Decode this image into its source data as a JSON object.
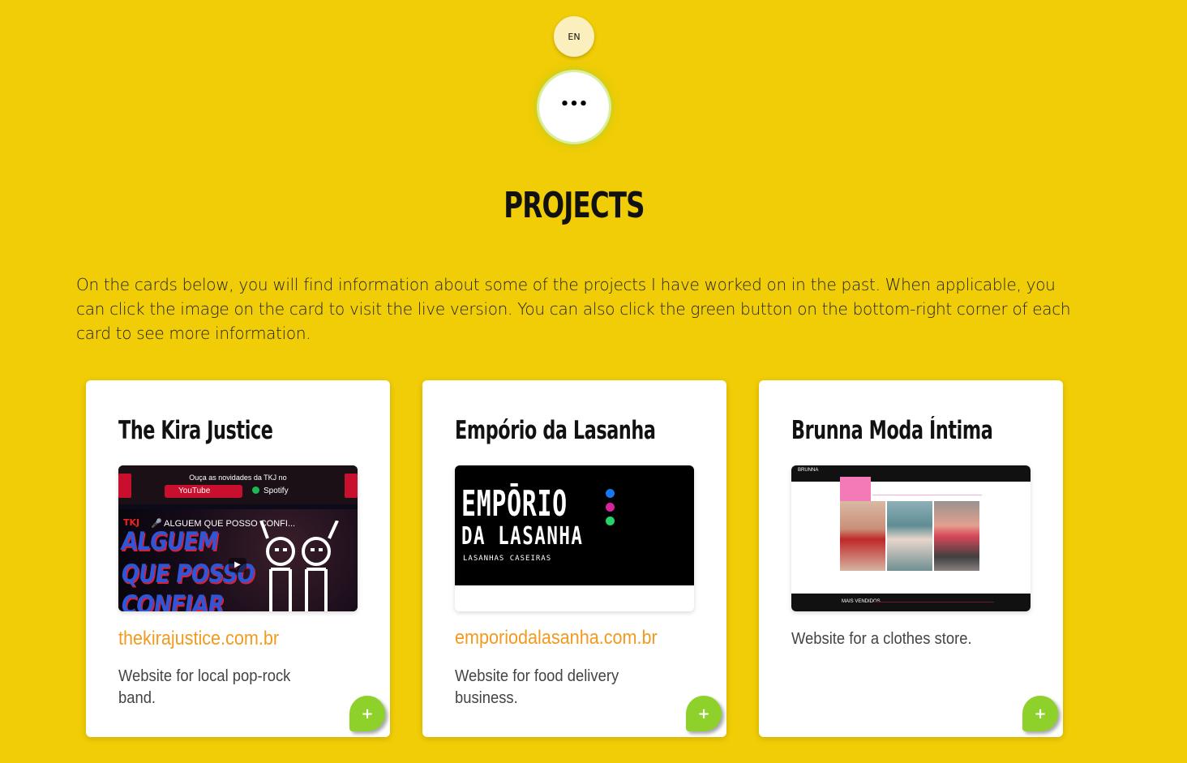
{
  "header": {
    "lang_button": "EN",
    "menu_button": "•••"
  },
  "section": {
    "title": "PROJECTS",
    "intro": "On the cards below, you will find information about some of the projects I have worked on in the past. When applicable, you can click the image on the card to visit the live version. You can also click the green button on the bottom-right corner of each card to see more information."
  },
  "cards": [
    {
      "title": "The Kira Justice",
      "link": "thekirajustice.com.br",
      "description": "Website for local pop-rock band.",
      "more_button": "+",
      "thumb": {
        "heading": "Ouça as novidades da TKJ no",
        "youtube": "YouTube",
        "spotify": "Spotify",
        "video_title": "🎤 ALGUEM QUE POSSO CONFI...",
        "tkj_logo": "TKJ",
        "line1": "ALGUEM",
        "line2": "QUE POSSO",
        "line3": "CONFIAR"
      }
    },
    {
      "title": "Empório da Lasanha",
      "link": "emporiodalasanha.com.br",
      "description": "Website for food delivery business.",
      "more_button": "+",
      "thumb": {
        "line1": "EMPŌRIO",
        "line2": "DA LASANHA",
        "line3": "LASANHAS CASEIRAS"
      }
    },
    {
      "title": "Brunna Moda Íntima",
      "link": "",
      "description": "Website for a clothes store.",
      "more_button": "+",
      "thumb": {
        "brand": "BRUNNA",
        "footer_label": "MAIS VENDIDOS"
      }
    }
  ],
  "colors": {
    "background": "#f0cd06",
    "link": "#f39a1e",
    "more_button": "#8fd12b"
  },
  "icons": {
    "menu": "more-horizontal-icon",
    "more": "plus-icon"
  }
}
